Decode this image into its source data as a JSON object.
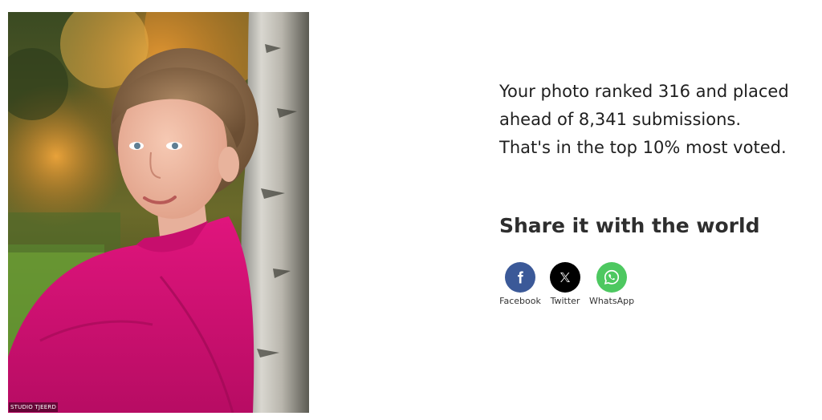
{
  "photo": {
    "watermark": "STUDIO TJEERD"
  },
  "result": {
    "lines": [
      "Your photo ranked 316 and placed",
      "ahead of 8,341 submissions.",
      "That's in the top 10% most voted."
    ]
  },
  "share": {
    "title": "Share it with the world",
    "buttons": [
      {
        "label": "Facebook",
        "icon": "facebook-icon",
        "color": "#3b5998"
      },
      {
        "label": "Twitter",
        "icon": "x-icon",
        "color": "#000000"
      },
      {
        "label": "WhatsApp",
        "icon": "whatsapp-icon",
        "color": "#4dc860"
      }
    ]
  }
}
